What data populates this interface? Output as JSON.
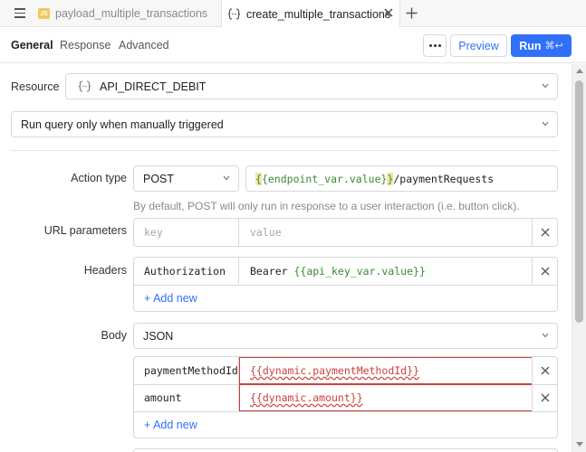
{
  "tabs": {
    "tab1": {
      "badge": "JS",
      "label": "payload_multiple_transactions"
    },
    "tab2": {
      "label": "create_multiple_transactions"
    }
  },
  "toolbar": {
    "subtabs": [
      "General",
      "Response",
      "Advanced"
    ],
    "preview_label": "Preview",
    "run_label": "Run",
    "run_shortcut": "⌘↩"
  },
  "resource": {
    "label": "Resource",
    "value": "API_DIRECT_DEBIT"
  },
  "trigger": {
    "value": "Run query only when manually triggered"
  },
  "action": {
    "label": "Action type",
    "method": "POST",
    "url_tmpl_open": "{",
    "url_tmpl_open2": "{",
    "url_var": "endpoint_var.value",
    "url_tmpl_close": "}",
    "url_tmpl_close2": "}",
    "url_path": "/paymentRequests",
    "help": "By default, POST will only run in response to a user interaction (i.e. button click)."
  },
  "url_params": {
    "label": "URL parameters",
    "key_placeholder": "key",
    "value_placeholder": "value"
  },
  "headers": {
    "label": "Headers",
    "rows": [
      {
        "key": "Authorization",
        "value_prefix": "Bearer ",
        "value_tmpl": "{{api_key_var.value}}"
      }
    ],
    "add_new": "+ Add new"
  },
  "body": {
    "label": "Body",
    "type": "JSON",
    "rows": [
      {
        "key": "paymentMethodId",
        "value": "{{dynamic.paymentMethodId}}"
      },
      {
        "key": "amount",
        "value": "{{dynamic.amount}}"
      }
    ],
    "add_new": "+ Add new"
  },
  "colors": {
    "accent": "#3170f9",
    "error": "#c9423c",
    "template_green": "#3a8a33",
    "js_badge": "#f0c95c"
  }
}
